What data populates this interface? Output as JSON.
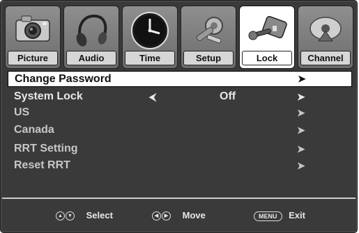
{
  "tabs": [
    {
      "label": "Picture",
      "icon": "camera-icon"
    },
    {
      "label": "Audio",
      "icon": "headphones-icon"
    },
    {
      "label": "Time",
      "icon": "clock-icon"
    },
    {
      "label": "Setup",
      "icon": "tools-icon"
    },
    {
      "label": "Lock",
      "icon": "key-lock-icon",
      "active": true
    },
    {
      "label": "Channel",
      "icon": "satellite-dish-icon"
    }
  ],
  "menu": {
    "items": [
      {
        "label": "Change Password",
        "arrow": "➤",
        "selected": true
      },
      {
        "label": "System Lock",
        "left_arrow": "⮜",
        "value": "Off",
        "arrow": "➤"
      },
      {
        "label": "US",
        "arrow": "➤"
      },
      {
        "label": "Canada",
        "arrow": "➤"
      },
      {
        "label": "RRT Setting",
        "arrow": "➤"
      },
      {
        "label": "Reset RRT",
        "arrow": "➤"
      }
    ]
  },
  "footer": {
    "select_icon": "up-down-buttons-icon",
    "select_label": "Select",
    "move_icon": "left-right-buttons-icon",
    "move_label": "Move",
    "menu_key": "MENU",
    "exit_label": "Exit"
  },
  "colors": {
    "background": "#3a3a3a",
    "tab": "#7d7d7d",
    "active_tab": "#ffffff",
    "text": "#e8e8e8"
  }
}
